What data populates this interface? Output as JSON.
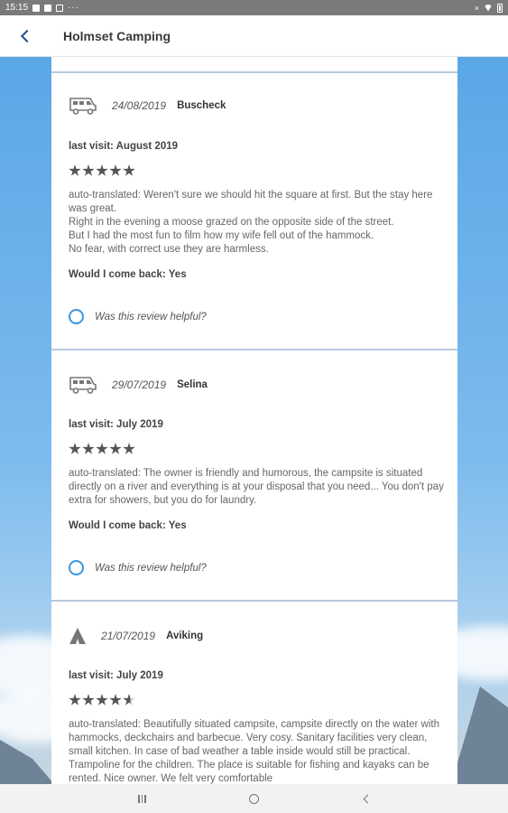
{
  "status_bar": {
    "time": "15:15",
    "dots": "···",
    "mute_icon": "×"
  },
  "app_bar": {
    "title": "Holmset Camping",
    "back_icon": "chevron-left-icon"
  },
  "reviews": [
    {
      "vehicle_icon": "motorhome-icon",
      "date": "24/08/2019",
      "author": "Buscheck",
      "last_visit": "last visit: August 2019",
      "rating": 5,
      "text": "auto-translated: Weren't sure we should hit the square at first. But the stay here was great.\nRight in the evening a moose grazed on the opposite side of the street.\nBut I had the most fun to film how my wife fell out of the hammock.\nNo fear, with correct use they are harmless.",
      "come_back": "Would I come back: Yes",
      "helpful_label": "Was this review helpful?"
    },
    {
      "vehicle_icon": "motorhome-icon",
      "date": "29/07/2019",
      "author": "Selina",
      "last_visit": "last visit: July 2019",
      "rating": 5,
      "text": "auto-translated: The owner is friendly and humorous, the campsite is situated directly on a river and everything is at your disposal that you need... You don't pay extra for showers, but you do for laundry.",
      "come_back": "Would I come back: Yes",
      "helpful_label": "Was this review helpful?"
    },
    {
      "vehicle_icon": "tent-icon",
      "date": "21/07/2019",
      "author": "Aviking",
      "last_visit": "last visit: July 2019",
      "rating": 4.5,
      "text": "auto-translated: Beautifully situated campsite, campsite directly on the water with hammocks, deckchairs and barbecue. Very cosy. Sanitary facilities very clean, small kitchen. In case of bad weather a table inside would still be practical. Trampoline for the children. The place is suitable for fishing and kayaks can be rented. Nice owner. We felt very comfortable"
    }
  ],
  "nav_bar": {
    "recents_icon": "recents-icon",
    "home_icon": "home-icon",
    "back_icon": "back-icon"
  },
  "colors": {
    "accent": "#3b97e0",
    "divider": "#b6c9de",
    "title_blue": "#1f4e8c"
  }
}
